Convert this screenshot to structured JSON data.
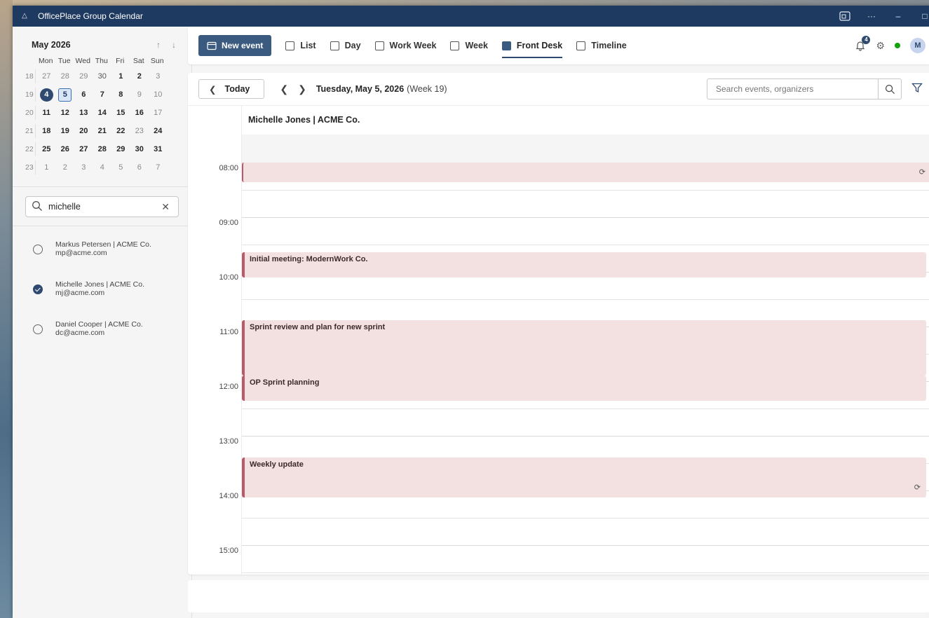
{
  "window": {
    "title": "OfficePlace Group Calendar"
  },
  "mini_calendar": {
    "month_title": "May 2026",
    "weekday_headers": [
      "Mon",
      "Tue",
      "Wed",
      "Thu",
      "Fri",
      "Sat",
      "Sun"
    ],
    "weeks": [
      {
        "wk": "18",
        "days": [
          "27",
          "28",
          "29",
          "30",
          "1",
          "2",
          "3"
        ]
      },
      {
        "wk": "19",
        "days": [
          "4",
          "5",
          "6",
          "7",
          "8",
          "9",
          "10"
        ]
      },
      {
        "wk": "20",
        "days": [
          "11",
          "12",
          "13",
          "14",
          "15",
          "16",
          "17"
        ]
      },
      {
        "wk": "21",
        "days": [
          "18",
          "19",
          "20",
          "21",
          "22",
          "23",
          "24"
        ]
      },
      {
        "wk": "22",
        "days": [
          "25",
          "26",
          "27",
          "28",
          "29",
          "30",
          "31"
        ]
      },
      {
        "wk": "23",
        "days": [
          "1",
          "2",
          "3",
          "4",
          "5",
          "6",
          "7"
        ]
      }
    ]
  },
  "people_search": {
    "value": "michelle"
  },
  "people": [
    {
      "name": "Markus Petersen | ACME Co.",
      "email": "mp@acme.com",
      "selected": false
    },
    {
      "name": "Michelle Jones | ACME Co.",
      "email": "mj@acme.com",
      "selected": true
    },
    {
      "name": "Daniel Cooper | ACME Co.",
      "email": "dc@acme.com",
      "selected": false
    }
  ],
  "toolbar": {
    "new_event": "New event",
    "views": [
      "List",
      "Day",
      "Work Week",
      "Week",
      "Front Desk",
      "Timeline"
    ],
    "active_view": "Front Desk",
    "notification_count": "4",
    "avatar_initial": "M",
    "status_color": "#13a10e"
  },
  "navbar": {
    "today": "Today",
    "date": "Tuesday, May 5, 2026",
    "week": "(Week 19)",
    "search_placeholder": "Search events, organizers"
  },
  "resource": {
    "name": "Michelle Jones | ACME Co."
  },
  "time_labels": [
    "08:00",
    "09:00",
    "10:00",
    "11:00",
    "12:00",
    "13:00",
    "14:00",
    "15:00"
  ],
  "events": [
    {
      "title": "",
      "recurring": true
    },
    {
      "title": "Initial meeting: ModernWork Co.",
      "recurring": false
    },
    {
      "title": "Sprint review and plan for new sprint",
      "recurring": false
    },
    {
      "title": "OP Sprint planning",
      "recurring": false
    },
    {
      "title": "Weekly update",
      "recurring": true
    }
  ],
  "colors": {
    "accent": "#2f4a70",
    "event_bg": "#f3e1e1",
    "event_border": "#b85a68",
    "titlebar": "#1f3a60"
  }
}
